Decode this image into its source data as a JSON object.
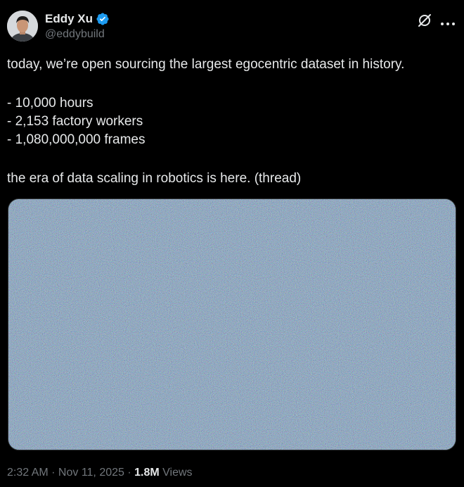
{
  "author": {
    "display_name": "Eddy Xu",
    "handle": "@eddybuild",
    "verified": true,
    "avatar_icon": "profile-photo"
  },
  "actions": {
    "grok_icon": "grok-icon",
    "more_icon": "more-horizontal-icon"
  },
  "tweet": {
    "intro": "today, we’re open sourcing the largest egocentric dataset in history.",
    "bullets": [
      "- 10,000 hours",
      "- 2,153 factory workers",
      "- 1,080,000,000 frames"
    ],
    "closing": "the era of data scaling in robotics is here. (thread)"
  },
  "media": {
    "type": "image",
    "description_icon": "noise-image"
  },
  "meta": {
    "time": "2:32 AM",
    "separator": " · ",
    "date": "Nov 11, 2025",
    "views_count": "1.8M",
    "views_label": " Views"
  },
  "colors": {
    "background": "#000000",
    "text": "#e7e9ea",
    "secondary": "#71767b",
    "verified": "#1d9bf0"
  }
}
